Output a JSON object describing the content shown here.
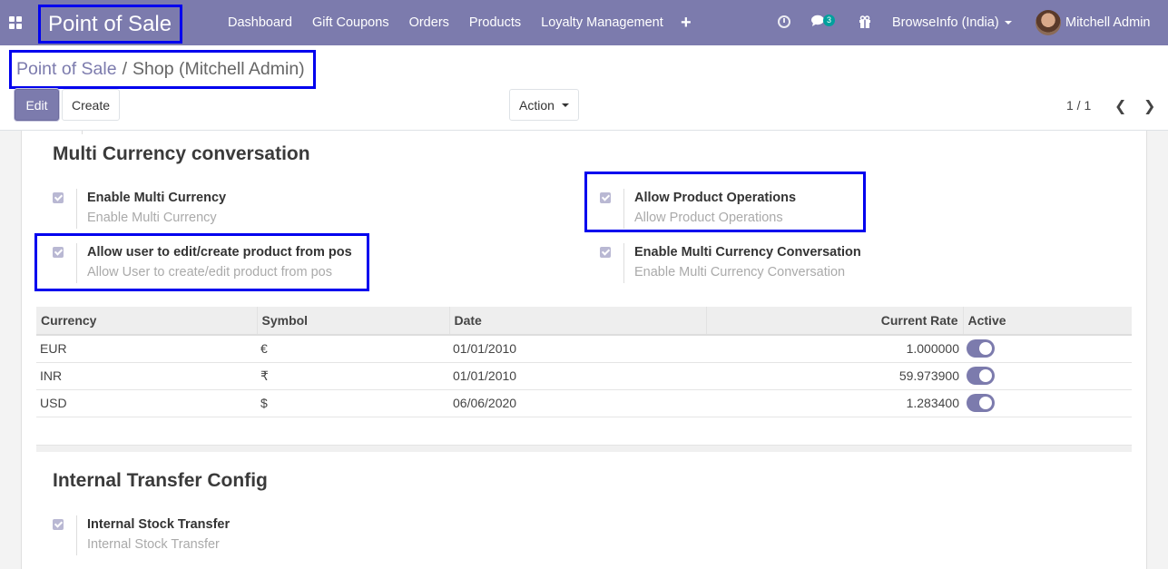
{
  "navbar": {
    "brand": "Point of Sale",
    "menu": [
      "Dashboard",
      "Gift Coupons",
      "Orders",
      "Products",
      "Loyalty Management"
    ],
    "chat_count": "3",
    "company": "BrowseInfo (India)",
    "user": "Mitchell Admin",
    "icons": [
      "apps-icon",
      "plus-icon",
      "clock-icon",
      "chat-icon",
      "gift-icon"
    ]
  },
  "breadcrumb": {
    "parent": "Point of Sale",
    "separator": "/",
    "current": "Shop (Mitchell Admin)"
  },
  "toolbar": {
    "edit": "Edit",
    "create": "Create",
    "action": "Action",
    "pager": "1 / 1"
  },
  "multi_currency": {
    "title": "Multi Currency conversation",
    "settings": [
      {
        "label": "Enable Multi Currency",
        "desc": "Enable Multi Currency",
        "checked": true
      },
      {
        "label": "Allow Product Operations",
        "desc": "Allow Product Operations",
        "checked": true
      },
      {
        "label": "Allow user to edit/create product from pos",
        "desc": "Allow User to create/edit product from pos",
        "checked": true
      },
      {
        "label": "Enable Multi Currency Conversation",
        "desc": "Enable Multi Currency Conversation",
        "checked": true
      }
    ],
    "table": {
      "headers": [
        "Currency",
        "Symbol",
        "Date",
        "Current Rate",
        "Active"
      ],
      "rows": [
        {
          "currency": "EUR",
          "symbol": "€",
          "date": "01/01/2010",
          "rate": "1.000000",
          "active": true
        },
        {
          "currency": "INR",
          "symbol": "₹",
          "date": "01/01/2010",
          "rate": "59.973900",
          "active": true
        },
        {
          "currency": "USD",
          "symbol": "$",
          "date": "06/06/2020",
          "rate": "1.283400",
          "active": true
        }
      ]
    }
  },
  "internal_transfer": {
    "title": "Internal Transfer Config",
    "settings": [
      {
        "label": "Internal Stock Transfer",
        "desc": "Internal Stock Transfer",
        "checked": true
      }
    ]
  },
  "colors": {
    "brand": "#7c7bad",
    "highlight": "#0000ee",
    "badge": "#00a09d"
  }
}
